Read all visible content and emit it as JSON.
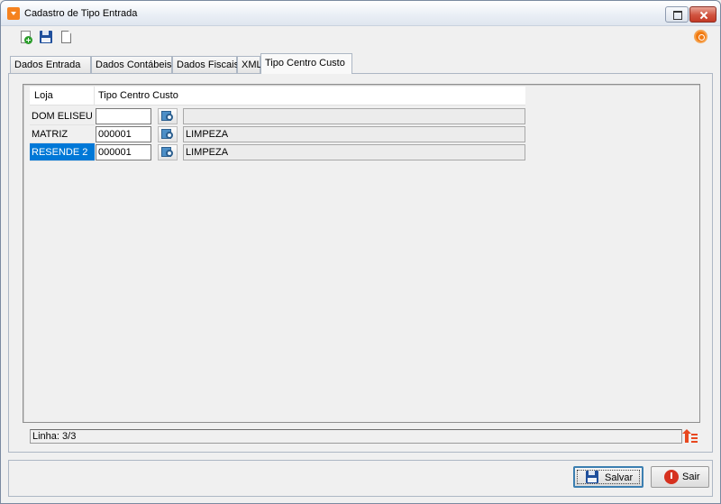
{
  "window": {
    "title": "Cadastro de Tipo Entrada"
  },
  "toolbar": {
    "icons": [
      "new-document-icon",
      "save-icon",
      "copy-document-icon"
    ],
    "help_icon": "help-icon"
  },
  "tabs": [
    {
      "label": "Dados Entrada",
      "active": false
    },
    {
      "label": "Dados Contábeis",
      "active": false
    },
    {
      "label": "Dados Fiscais",
      "active": false
    },
    {
      "label": "XML",
      "active": false
    },
    {
      "label": "Tipo Centro Custo",
      "active": true
    }
  ],
  "grid": {
    "columns": [
      "Loja",
      "Tipo Centro Custo"
    ],
    "rows": [
      {
        "loja": "DOM ELISEU",
        "code": "",
        "description": "",
        "selected": false
      },
      {
        "loja": "MATRIZ",
        "code": "000001",
        "description": "LIMPEZA",
        "selected": false
      },
      {
        "loja": "RESENDE 2",
        "code": "000001",
        "description": "LIMPEZA",
        "selected": true
      }
    ]
  },
  "status": {
    "text": "Linha: 3/3"
  },
  "footer": {
    "save_label": "Salvar",
    "exit_label": "Sair"
  },
  "colors": {
    "selection": "#0078d7",
    "accent_orange": "#f17a12",
    "exit_red": "#d6311f"
  }
}
